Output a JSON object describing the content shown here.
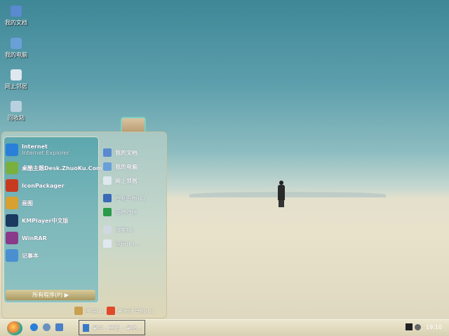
{
  "desktop_icons": [
    {
      "label": "我的文档",
      "icon": "my-documents-icon",
      "color": "#5a8ad0"
    },
    {
      "label": "我的电脑",
      "icon": "my-computer-icon",
      "color": "#6aa0d8"
    },
    {
      "label": "网上邻居",
      "icon": "network-icon",
      "color": "#dfe8ee"
    },
    {
      "label": "回收站",
      "icon": "recycle-bin-icon",
      "color": "#b8d0e0"
    }
  ],
  "start_menu": {
    "pinned": [
      {
        "label": "Internet",
        "sublabel": "Internet Explorer",
        "icon": "internet-explorer-icon",
        "color": "#2a7fd8"
      },
      {
        "label": "桌酷主题Desk.ZhuoKu.Com",
        "icon": "zhuoku-icon",
        "color": "#7ab040"
      },
      {
        "label": "IconPackager",
        "icon": "iconpackager-icon",
        "color": "#c83a20"
      },
      {
        "label": "画图",
        "icon": "paint-icon",
        "color": "#d8a030"
      },
      {
        "label": "KMPlayer中文版",
        "icon": "kmplayer-icon",
        "color": "#1a3a60"
      },
      {
        "label": "WinRAR",
        "icon": "winrar-icon",
        "color": "#8a3a8a"
      },
      {
        "label": "记事本",
        "icon": "notepad-icon",
        "color": "#4a90d0"
      }
    ],
    "all_programs": "所有程序(P)",
    "places": [
      {
        "label": "我的文档",
        "icon": "my-documents-icon",
        "bold": true,
        "color": "#5a8ad0"
      },
      {
        "label": "我的电脑",
        "icon": "my-computer-icon",
        "bold": true,
        "color": "#6aa0d8"
      },
      {
        "label": "网上邻居",
        "icon": "network-icon",
        "bold": true,
        "color": "#dfe8ee"
      },
      {
        "label": "控制面板(C)",
        "icon": "control-panel-icon",
        "bold": false,
        "color": "#3a6ab8"
      },
      {
        "label": "网络连接",
        "icon": "network-connections-icon",
        "bold": false,
        "color": "#2a9a4a"
      },
      {
        "label": "搜索(S)",
        "icon": "search-icon",
        "bold": false,
        "color": "#d0d8e0"
      },
      {
        "label": "运行(R)...",
        "icon": "run-icon",
        "bold": false,
        "color": "#e0e8f0"
      }
    ],
    "logoff": "注销(L)",
    "shutdown": "关闭计算机(U)"
  },
  "taskbar": {
    "task": "桌面 - 壁纸 - 桌酷...",
    "clock": "19:10"
  }
}
